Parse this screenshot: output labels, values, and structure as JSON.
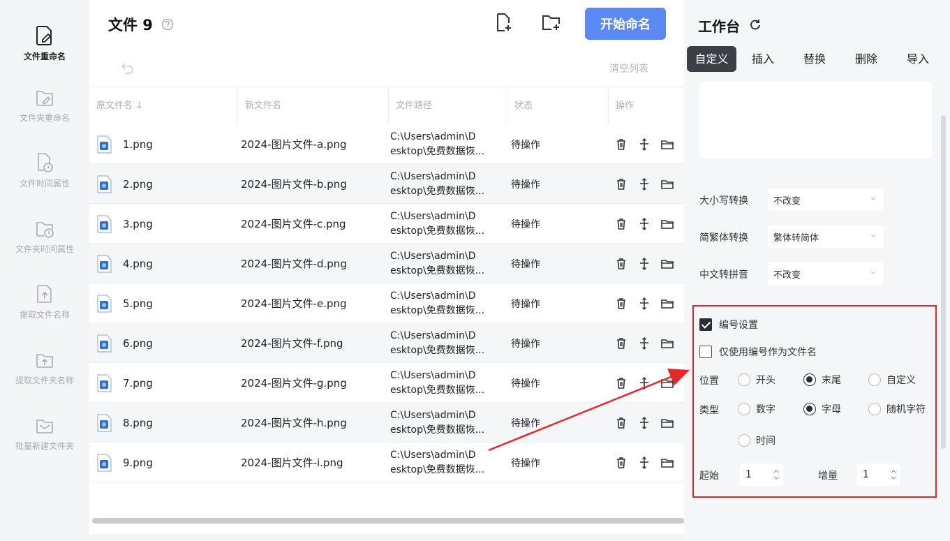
{
  "sidebar": {
    "items": [
      {
        "label": "文件重命名",
        "icon": "file-edit-icon",
        "active": true
      },
      {
        "label": "文件夹重命名",
        "icon": "folder-edit-icon",
        "active": false
      },
      {
        "label": "文件时间属性",
        "icon": "file-clock-icon",
        "active": false
      },
      {
        "label": "文件夹时间属性",
        "icon": "folder-clock-icon",
        "active": false
      },
      {
        "label": "提取文件名称",
        "icon": "file-upload-icon",
        "active": false
      },
      {
        "label": "提取文件夹名称",
        "icon": "folder-upload-icon",
        "active": false
      },
      {
        "label": "批量新建文件夹",
        "icon": "folder-mail-icon",
        "active": false
      }
    ]
  },
  "main": {
    "title": "文件 9",
    "start_button": "开始命名",
    "clear_list": "清空列表",
    "columns": [
      "原文件名 ↓",
      "新文件名",
      "文件路径",
      "状态",
      "操作"
    ],
    "rows": [
      {
        "original": "1.png",
        "new": "2024-图片文件-a.png",
        "path1": "C:\\Users\\admin\\D",
        "path2": "esktop\\免费数据恢...",
        "status": "待操作"
      },
      {
        "original": "2.png",
        "new": "2024-图片文件-b.png",
        "path1": "C:\\Users\\admin\\D",
        "path2": "esktop\\免费数据恢...",
        "status": "待操作"
      },
      {
        "original": "3.png",
        "new": "2024-图片文件-c.png",
        "path1": "C:\\Users\\admin\\D",
        "path2": "esktop\\免费数据恢...",
        "status": "待操作"
      },
      {
        "original": "4.png",
        "new": "2024-图片文件-d.png",
        "path1": "C:\\Users\\admin\\D",
        "path2": "esktop\\免费数据恢...",
        "status": "待操作"
      },
      {
        "original": "5.png",
        "new": "2024-图片文件-e.png",
        "path1": "C:\\Users\\admin\\D",
        "path2": "esktop\\免费数据恢...",
        "status": "待操作"
      },
      {
        "original": "6.png",
        "new": "2024-图片文件-f.png",
        "path1": "C:\\Users\\admin\\D",
        "path2": "esktop\\免费数据恢...",
        "status": "待操作"
      },
      {
        "original": "7.png",
        "new": "2024-图片文件-g.png",
        "path1": "C:\\Users\\admin\\D",
        "path2": "esktop\\免费数据恢...",
        "status": "待操作"
      },
      {
        "original": "8.png",
        "new": "2024-图片文件-h.png",
        "path1": "C:\\Users\\admin\\D",
        "path2": "esktop\\免费数据恢...",
        "status": "待操作"
      },
      {
        "original": "9.png",
        "new": "2024-图片文件-i.png",
        "path1": "C:\\Users\\admin\\D",
        "path2": "esktop\\免费数据恢...",
        "status": "待操作"
      }
    ]
  },
  "workbench": {
    "title": "工作台",
    "tabs": [
      "自定义",
      "插入",
      "替换",
      "删除",
      "导入"
    ],
    "active_tab": "自定义",
    "case_label": "大小写转换",
    "case_value": "不改变",
    "trad_label": "简繁体转换",
    "trad_value": "繁体转简体",
    "pinyin_label": "中文转拼音",
    "pinyin_value": "不改变",
    "numbering": {
      "enable_label": "编号设置",
      "enabled": true,
      "only_number_label": "仅使用编号作为文件名",
      "only_number": false,
      "position_label": "位置",
      "position_options": [
        "开头",
        "末尾",
        "自定义"
      ],
      "position_selected": "末尾",
      "type_label": "类型",
      "type_options": [
        "数字",
        "字母",
        "随机字符",
        "时间"
      ],
      "type_selected": "字母",
      "start_label": "起始",
      "start_value": "1",
      "step_label": "增量",
      "step_value": "1"
    }
  },
  "colors": {
    "accent": "#5b8af5",
    "highlight_box": "#e8262a",
    "active_tab": "#3d3f47"
  }
}
